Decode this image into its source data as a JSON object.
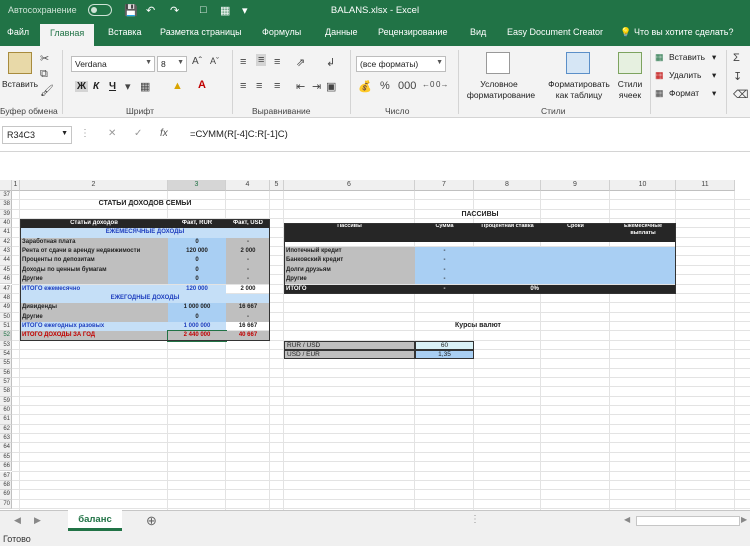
{
  "window": {
    "title": "BALANS.xlsx  -  Excel",
    "autosave": "Автосохранение"
  },
  "tabs": [
    "Файл",
    "Главная",
    "Вставка",
    "Разметка страницы",
    "Формулы",
    "Данные",
    "Рецензирование",
    "Вид",
    "Easy Document Creator"
  ],
  "tell_me": "Что вы хотите сделать?",
  "ribbon": {
    "clipboard": {
      "paste": "Вставить",
      "label": "Буфер обмена"
    },
    "font": {
      "name": "Verdana",
      "size": "8",
      "bold": "Ж",
      "italic": "К",
      "underline": "Ч",
      "label": "Шрифт"
    },
    "alignment": {
      "label": "Выравнивание"
    },
    "number": {
      "format": "(все форматы)",
      "label": "Число"
    },
    "styles": {
      "conditional1": "Условное",
      "conditional2": "форматирование",
      "table1": "Форматировать",
      "table2": "как таблицу",
      "cell1": "Стили",
      "cell2": "ячеек",
      "label": "Стили"
    },
    "cells": {
      "insert": "Вставить",
      "delete": "Удалить",
      "format": "Формат"
    }
  },
  "formula_bar": {
    "name_box": "R34C3",
    "fx": "fx",
    "formula": "=СУММ(R[-4]C:R[-1]C)"
  },
  "columns": [
    "1",
    "2",
    "3",
    "4",
    "5",
    "6",
    "7",
    "8",
    "9",
    "10",
    "11"
  ],
  "rows": [
    "37",
    "38",
    "39",
    "40",
    "41",
    "42",
    "43",
    "44",
    "45",
    "46",
    "47",
    "48",
    "49",
    "50",
    "51",
    "52",
    "53",
    "54",
    "55",
    "56",
    "57",
    "58",
    "59",
    "60",
    "61",
    "62",
    "63",
    "64",
    "65",
    "66",
    "67",
    "68",
    "69",
    "70"
  ],
  "income": {
    "title": "СТАТЬИ ДОХОДОВ СЕМЬИ",
    "headers": [
      "Статьи доходов",
      "Факт, RUR",
      "Факт, USD"
    ],
    "monthly_header": "ЕЖЕМЕСЯЧНЫЕ ДОХОДЫ",
    "monthly": [
      {
        "label": "Заработная плата",
        "rur": "0",
        "usd": "-"
      },
      {
        "label": "Рента от сдачи в аренду недвижимости",
        "rur": "120 000",
        "usd": "2 000"
      },
      {
        "label": "Проценты по депозитам",
        "rur": "0",
        "usd": "-"
      },
      {
        "label": "Доходы по ценным бумагам",
        "rur": "0",
        "usd": "-"
      },
      {
        "label": "Другие",
        "rur": "0",
        "usd": "-"
      }
    ],
    "monthly_total": {
      "label": "ИТОГО ежемесячно",
      "rur": "120 000",
      "usd": "2 000"
    },
    "yearly_header": "ЕЖЕГОДНЫЕ ДОХОДЫ",
    "yearly": [
      {
        "label": "Дивиденды",
        "rur": "1 000 000",
        "usd": "16 667"
      },
      {
        "label": "Другие",
        "rur": "0",
        "usd": "-"
      }
    ],
    "yearly_total": {
      "label": "ИТОГО ежегодных разовых",
      "rur": "1 000 000",
      "usd": "16 667"
    },
    "grand_total": {
      "label": "ИТОГО ДОХОДЫ ЗА ГОД",
      "rur": "2 440 000",
      "usd": "40 667"
    }
  },
  "liabilities": {
    "title": "ПАССИВЫ",
    "headers": [
      "Пассивы",
      "Сумма",
      "Процентная ставка",
      "Сроки",
      "Ежемесячные выплаты"
    ],
    "rows": [
      {
        "label": "Ипотечный кредит",
        "sum": "-"
      },
      {
        "label": "Банковский кредит",
        "sum": "-"
      },
      {
        "label": "Долги друзьям",
        "sum": "-"
      },
      {
        "label": "Другие",
        "sum": "-"
      }
    ],
    "total": {
      "label": "ИТОГО",
      "sum": "-",
      "rate": "0%"
    }
  },
  "rates": {
    "title": "Курсы валют",
    "rows": [
      {
        "label": "RUR / USD",
        "value": "60"
      },
      {
        "label": "USD / EUR",
        "value": "1,35"
      }
    ]
  },
  "sheet_tab": "баланс",
  "status": "Готово"
}
